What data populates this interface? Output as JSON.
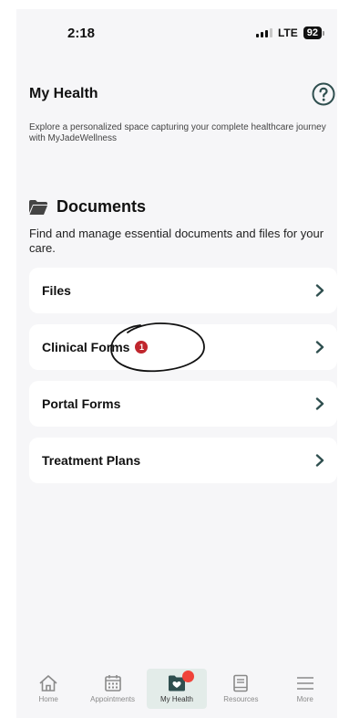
{
  "status_bar": {
    "time": "2:18",
    "network": "LTE",
    "battery": "92"
  },
  "header": {
    "title": "My Health",
    "intro": "Explore a personalized space capturing your complete healthcare journey with MyJadeWellness"
  },
  "documents": {
    "title": "Documents",
    "description": "Find and manage essential documents and files for your care.",
    "items": [
      {
        "label": "Files",
        "badge": ""
      },
      {
        "label": "Clinical Forms",
        "badge": "1"
      },
      {
        "label": "Portal Forms",
        "badge": ""
      },
      {
        "label": "Treatment Plans",
        "badge": ""
      }
    ]
  },
  "tabs": [
    {
      "label": "Home",
      "icon": "home-icon"
    },
    {
      "label": "Appointments",
      "icon": "calendar-icon"
    },
    {
      "label": "My Health",
      "icon": "health-folder-icon",
      "active": true
    },
    {
      "label": "Resources",
      "icon": "book-icon"
    },
    {
      "label": "More",
      "icon": "menu-icon"
    }
  ],
  "colors": {
    "accent": "#2f4f4f",
    "badge": "#c0262d",
    "active_tab_bg": "#e3ece9"
  }
}
